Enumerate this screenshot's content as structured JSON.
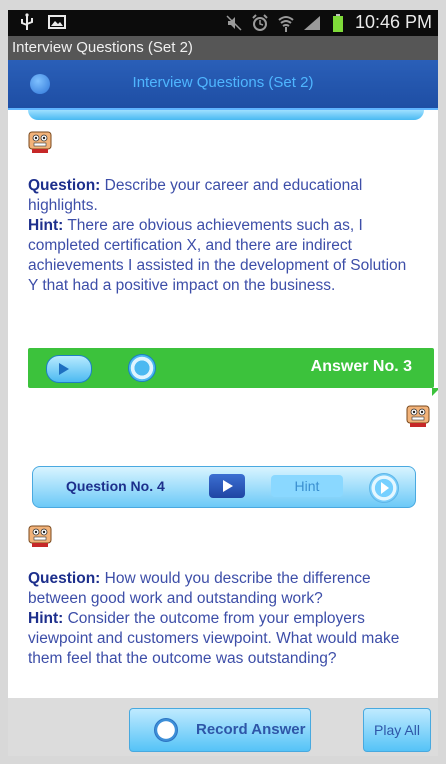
{
  "status_bar": {
    "time": "10:46 PM",
    "icons": [
      "usb-icon",
      "image-icon",
      "mute-icon",
      "alarm-icon",
      "wifi-icon",
      "signal-icon",
      "battery-icon"
    ]
  },
  "window_title": "Interview Questions (Set 2)",
  "header": {
    "title": "Interview Questions (Set 2)"
  },
  "q3": {
    "question_label": "Question:",
    "question_text": " Describe your career and educational highlights.",
    "hint_label": "Hint:",
    "hint_text": " There are obvious achievements such as, I completed certification X, and there are indirect achievements I assisted in the development of Solution Y that had a positive impact on the business."
  },
  "answer_bar": {
    "label": "Answer No. 3"
  },
  "question_bar": {
    "label": "Question No. 4",
    "hint_label": "Hint"
  },
  "q4": {
    "question_label": "Question:",
    "question_text": " How would you describe the difference between good work and outstanding work?",
    "hint_label": "Hint:",
    "hint_text": " Consider the outcome from your employers viewpoint and customers viewpoint. What would make them feel that the outcome was outstanding?"
  },
  "bottom_bar": {
    "record_label": "Record Answer",
    "play_all_label": "Play All"
  },
  "colors": {
    "header_bg": "#1e4ea4",
    "header_title": "#4fb6ff",
    "answer_bar": "#3cc23c",
    "text_body": "#3d4ea8",
    "text_bold": "#1d2f8c"
  }
}
